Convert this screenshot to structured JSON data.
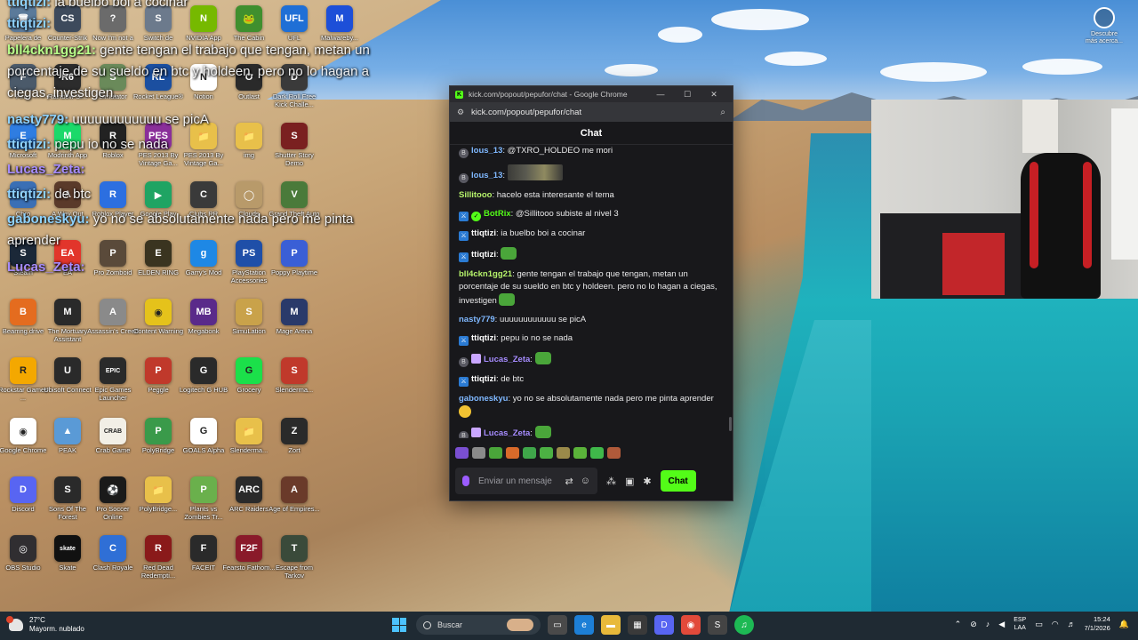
{
  "desktop": {
    "icons": [
      {
        "label": "Papelera de",
        "color": "#5b7a9a",
        "glyph": "🗑"
      },
      {
        "label": "Counter-Strik",
        "color": "#3d4a5c",
        "glyph": "CS"
      },
      {
        "label": "Now I'm not a",
        "color": "#6b6b6b",
        "glyph": "?"
      },
      {
        "label": "Switch de",
        "color": "#6c7a8c",
        "glyph": "S"
      },
      {
        "label": "NVIDIA App",
        "color": "#76b900",
        "glyph": "N"
      },
      {
        "label": "The Cabin",
        "color": "#3f8f2e",
        "glyph": "🐸"
      },
      {
        "label": "UFL",
        "color": "#1f6fd6",
        "glyph": "UFL"
      },
      {
        "label": "Malwareby...",
        "color": "#1d4fd8",
        "glyph": "M"
      },
      {
        "label": "Final",
        "color": "#4b5a6a",
        "glyph": "F"
      },
      {
        "label": "Rainbow Si...",
        "color": "#2c2c2c",
        "glyph": "R6"
      },
      {
        "label": "Simulator",
        "color": "#6a8a5a",
        "glyph": "S"
      },
      {
        "label": "Rocket League®",
        "color": "#1b4fa0",
        "glyph": "RL"
      },
      {
        "label": "Notion",
        "color": "#ffffff",
        "glyph": "N"
      },
      {
        "label": "Outlast",
        "color": "#2a2a2a",
        "glyph": "O"
      },
      {
        "label": "Dark Roll Free Kick Challe...",
        "color": "#3a3a3a",
        "glyph": "D"
      },
      {
        "label": "Microsoft",
        "color": "#2f7de1",
        "glyph": "E"
      },
      {
        "label": "Modrinth App",
        "color": "#1bd96a",
        "glyph": "M"
      },
      {
        "label": "Roblox",
        "color": "#222222",
        "glyph": "R"
      },
      {
        "label": "PES 2013 By Vintage Ga...",
        "color": "#8a2f9a",
        "glyph": "PES"
      },
      {
        "label": "PES 2013 By Vintage Ga...",
        "color": "#e8c04a",
        "glyph": "📁"
      },
      {
        "label": "img",
        "color": "#e8c04a",
        "glyph": "📁"
      },
      {
        "label": "Shutter Story Demo",
        "color": "#7a2020",
        "glyph": "S"
      },
      {
        "label": "Chro",
        "color": "#3a6fb5",
        "glyph": "C"
      },
      {
        "label": "A Way Out",
        "color": "#5a3a2a",
        "glyph": "A"
      },
      {
        "label": "Roblox Player",
        "color": "#2c6fe0",
        "glyph": "R"
      },
      {
        "label": "Google Play",
        "color": "#1fa463",
        "glyph": "▶"
      },
      {
        "label": "Clubs RR",
        "color": "#3a3a3a",
        "glyph": "C"
      },
      {
        "label": "Clouds",
        "color": "#b89a6a",
        "glyph": "◯"
      },
      {
        "label": "Grand Theft Auto V",
        "color": "#4a7a3a",
        "glyph": "V"
      },
      {
        "label": "Steam",
        "color": "#1b2838",
        "glyph": "S"
      },
      {
        "label": "EA",
        "color": "#e2352b",
        "glyph": "EA"
      },
      {
        "label": "Pro Zomboid",
        "color": "#5a4a3a",
        "glyph": "P"
      },
      {
        "label": "ELDEN RING",
        "color": "#3a3420",
        "glyph": "E"
      },
      {
        "label": "Garry's Mod",
        "color": "#1e88e5",
        "glyph": "g"
      },
      {
        "label": "PlayStation Accessories",
        "color": "#1f4fa8",
        "glyph": "PS"
      },
      {
        "label": "Poppy Playtime",
        "color": "#3a5fd6",
        "glyph": "P"
      },
      {
        "label": "Beamng.drive",
        "color": "#e46c1f",
        "glyph": "B"
      },
      {
        "label": "The Mortuary Assistant",
        "color": "#2a2a2a",
        "glyph": "M"
      },
      {
        "label": "Assassin's Creed",
        "color": "#8a8a8a",
        "glyph": "A"
      },
      {
        "label": "Content Warning",
        "color": "#e5c21b",
        "glyph": "◉"
      },
      {
        "label": "Megabonk",
        "color": "#5a2a8a",
        "glyph": "MB"
      },
      {
        "label": "SimuLation",
        "color": "#c9a24a",
        "glyph": "S"
      },
      {
        "label": "Mage Arena",
        "color": "#2a3a6a",
        "glyph": "M"
      },
      {
        "label": "Rockstar Games ...",
        "color": "#f4a800",
        "glyph": "R"
      },
      {
        "label": "Ubisoft Connect",
        "color": "#2a2a2a",
        "glyph": "U"
      },
      {
        "label": "Epic Games Launcher",
        "color": "#2a2a2a",
        "glyph": "EPIC"
      },
      {
        "label": "Peggle",
        "color": "#c0392b",
        "glyph": "P"
      },
      {
        "label": "Logitech G HUB",
        "color": "#2a2a2a",
        "glyph": "G"
      },
      {
        "label": "Grocery",
        "color": "#1be04a",
        "glyph": "G"
      },
      {
        "label": "Slenderma...",
        "color": "#c0392b",
        "glyph": "S"
      },
      {
        "label": "Google Chrome",
        "color": "#ffffff",
        "glyph": "◉"
      },
      {
        "label": "PEAK",
        "color": "#5a9ad6",
        "glyph": "▲"
      },
      {
        "label": "Crab Game",
        "color": "#f2efe6",
        "glyph": "CRAB"
      },
      {
        "label": "PolyBridge",
        "color": "#3a9a4a",
        "glyph": "P"
      },
      {
        "label": "GOALS Alpha",
        "color": "#ffffff",
        "glyph": "G"
      },
      {
        "label": "Slenderma...",
        "color": "#e8c04a",
        "glyph": "📁"
      },
      {
        "label": "Zort",
        "color": "#2a2a2a",
        "glyph": "Z"
      },
      {
        "label": "Discord",
        "color": "#5865f2",
        "glyph": "D"
      },
      {
        "label": "Sons Of The Forest",
        "color": "#2a2a2a",
        "glyph": "S"
      },
      {
        "label": "Pro Soccer Online",
        "color": "#1a1a1a",
        "glyph": "⚽"
      },
      {
        "label": "PolyBridge...",
        "color": "#e8c04a",
        "glyph": "📁"
      },
      {
        "label": "Plants vs Zombies Tr...",
        "color": "#6ab04c",
        "glyph": "P"
      },
      {
        "label": "ARC Raiders",
        "color": "#2a2a2a",
        "glyph": "ARC"
      },
      {
        "label": "Age of Empires...",
        "color": "#6a3a2a",
        "glyph": "A"
      },
      {
        "label": "OBS Studio",
        "color": "#302e31",
        "glyph": "◎"
      },
      {
        "label": "Skate",
        "color": "#111111",
        "glyph": "skate"
      },
      {
        "label": "Clash Royale",
        "color": "#2f6fd6",
        "glyph": "C"
      },
      {
        "label": "Red Dead Redempti...",
        "color": "#8a1a1a",
        "glyph": "R"
      },
      {
        "label": "FACEIT",
        "color": "#2a2a2a",
        "glyph": "F"
      },
      {
        "label": "Fearsto Fathom...",
        "color": "#8a1a2a",
        "glyph": "F2F"
      },
      {
        "label": "Escape from Tarkov",
        "color": "#3a4a3a",
        "glyph": "T"
      }
    ],
    "discover": {
      "label": "Descubre más acerca..."
    }
  },
  "overlay_chat": [
    {
      "user": "ttiqtizi:",
      "text": " ia buelbo boi a cocinar",
      "color": "#8fd3ff"
    },
    {
      "user": "ttiqtizi:",
      "text": "",
      "color": "#8fd3ff"
    },
    {
      "user": "bll4ckn1gg21:",
      "text": " gente tengan el trabajo que tengan, metan un",
      "color": "#b8ff8a"
    },
    {
      "user": "",
      "text": "porcentaje de su sueldo en btc y holdeen. pero no lo hagan a",
      "color": "#ffffff"
    },
    {
      "user": "",
      "text": "ciegas, investigen.",
      "color": "#ffffff"
    },
    {
      "user": "nasty779:",
      "text": " uuuuuuuuuuuu se picA",
      "color": "#8fd3ff"
    },
    {
      "user": "ttiqtizi:",
      "text": " pepu io no se nada",
      "color": "#8fd3ff"
    },
    {
      "user": "Lucas_Zeta:",
      "text": "",
      "color": "#a68cff"
    },
    {
      "user": "ttiqtizi:",
      "text": " de btc",
      "color": "#8fd3ff"
    },
    {
      "user": "gaboneskyu:",
      "text": " yo no se absolutamente nada pero me pinta",
      "color": "#8fd3ff"
    },
    {
      "user": "",
      "text": "aprender",
      "color": "#ffffff"
    },
    {
      "user": "Lucas_Zeta:",
      "text": "",
      "color": "#a68cff"
    }
  ],
  "browser": {
    "title": "kick.com/popout/pepufor/chat - Google Chrome",
    "url": "kick.com/popout/pepufor/chat",
    "header": "Chat"
  },
  "chat": {
    "messages": [
      {
        "badges": [
          "og"
        ],
        "user": "lous_13",
        "user_color": "#7fb8ff",
        "text": "@TXRO_HOLDEO me mori",
        "emote": ""
      },
      {
        "badges": [
          "og"
        ],
        "user": "lous_13",
        "user_color": "#7fb8ff",
        "text": "",
        "emote": "big"
      },
      {
        "badges": [],
        "user": "Sillitooo",
        "user_color": "#b6f36b",
        "text": "hacelo esta interesante el tema",
        "emote": ""
      },
      {
        "badges": [
          "mod",
          "verified"
        ],
        "user": "BotRix",
        "user_color": "#53fc18",
        "text": "@Sillitooo subiste al nivel 3",
        "emote": ""
      },
      {
        "badges": [
          "mod"
        ],
        "user": "ttiqtizi",
        "user_color": "#ffffff",
        "text": "ia buelbo boi a cocinar",
        "emote": ""
      },
      {
        "badges": [
          "mod"
        ],
        "user": "ttiqtizi",
        "user_color": "#ffffff",
        "text": "",
        "emote": "green"
      },
      {
        "badges": [],
        "user": "bll4ckn1gg21",
        "user_color": "#b6f36b",
        "text": "gente tengan el trabajo que tengan, metan un porcentaje de su sueldo en btc y holdeen. pero no lo hagan a ciegas, investigen",
        "emote": "green"
      },
      {
        "badges": [],
        "user": "nasty779",
        "user_color": "#7fb8ff",
        "text": "uuuuuuuuuuuu se picA",
        "emote": ""
      },
      {
        "badges": [
          "mod"
        ],
        "user": "ttiqtizi",
        "user_color": "#ffffff",
        "text": "pepu io no se nada",
        "emote": ""
      },
      {
        "badges": [
          "og",
          "sub"
        ],
        "user": "Lucas_Zeta",
        "user_color": "#a68cff",
        "text": "",
        "emote": "green"
      },
      {
        "badges": [
          "mod"
        ],
        "user": "ttiqtizi",
        "user_color": "#ffffff",
        "text": "de btc",
        "emote": ""
      },
      {
        "badges": [],
        "user": "gaboneskyu",
        "user_color": "#7fb8ff",
        "text": "yo no se absolutamente nada pero me pinta aprender",
        "emote": "yellow"
      },
      {
        "badges": [
          "og",
          "sub"
        ],
        "user": "Lucas_Zeta",
        "user_color": "#a68cff",
        "text": "",
        "emote": "green"
      }
    ],
    "input_placeholder": "Enviar un mensaje",
    "send_label": "Chat"
  },
  "taskbar": {
    "weather_temp": "27°C",
    "weather_desc": "Mayorm. nublado",
    "search_label": "Buscar",
    "lang_1": "ESP",
    "lang_2": "LAA",
    "time": "15:24",
    "date": "7/1/2026"
  }
}
